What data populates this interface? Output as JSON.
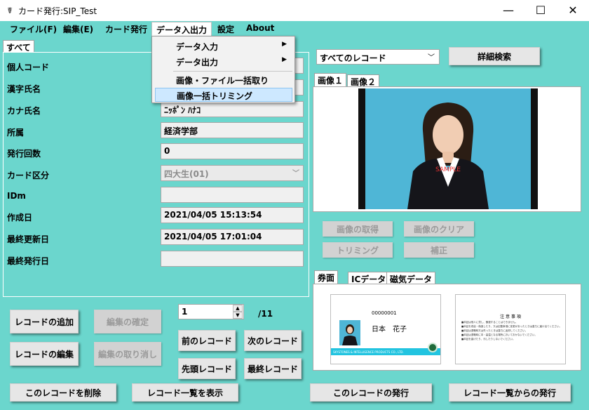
{
  "window": {
    "title": "カード発行:SIP_Test",
    "icon": "card-app-icon",
    "minimize": "—",
    "maximize": "☐",
    "close": "✕"
  },
  "menu": [
    "ファイル(F)",
    "編集(E)",
    "カード発行",
    "データ入出力",
    "設定",
    "About"
  ],
  "dropdown": {
    "items": [
      {
        "label": "データ入力",
        "submenu": true
      },
      {
        "label": "データ出力",
        "submenu": true
      },
      {
        "label": "画像・ファイル一括取り込み",
        "submenu": false
      },
      {
        "label": "画像一括トリミング",
        "submenu": false,
        "selected": true
      }
    ],
    "arrow": "▶"
  },
  "left_tab": "すべて",
  "fields": [
    {
      "label": "個人コード",
      "value": ""
    },
    {
      "label": "漢字氏名",
      "value": ""
    },
    {
      "label": "カナ氏名",
      "value": "ﾆｯﾎﾟﾝ ﾊﾅｺ"
    },
    {
      "label": "所属",
      "value": "経済学部"
    },
    {
      "label": "発行回数",
      "value": "0"
    },
    {
      "label": "カード区分",
      "value": "四大生(01)",
      "dropdown": true,
      "disabled": true
    },
    {
      "label": "IDm",
      "value": ""
    },
    {
      "label": "作成日",
      "value": "2021/04/05 15:13:54"
    },
    {
      "label": "最終更新日",
      "value": "2021/04/05 17:01:04"
    },
    {
      "label": "最終発行日",
      "value": ""
    }
  ],
  "dropdown_arrow": "﹀",
  "record_select": {
    "value": "すべてのレコード",
    "arrow": "﹀"
  },
  "buttons": {
    "detail_search": "詳細検索",
    "add_record": "レコードの追加",
    "confirm_edit": "編集の確定",
    "edit_record": "レコードの編集",
    "cancel_edit": "編集の取り消し",
    "prev_record": "前のレコード",
    "next_record": "次のレコード",
    "first_record": "先頭レコード",
    "last_record": "最終レコード",
    "delete_record": "このレコードを削除",
    "show_list": "レコード一覧を表示",
    "issue_record": "このレコードの発行",
    "issue_from_list": "レコード一覧からの発行",
    "get_image": "画像の取得",
    "clear_image": "画像のクリア",
    "trimming": "トリミング",
    "correction": "補正"
  },
  "record_nav": {
    "current": "1",
    "total": "/11",
    "up": "▲",
    "down": "▼"
  },
  "image_tabs": [
    "画像１",
    "画像２"
  ],
  "photo_watermark": "SAMPLE",
  "card_tabs": [
    "券面",
    "ICデータ",
    "磁気データ"
  ],
  "card_front": {
    "number": "00000001",
    "name": "日本　花子",
    "company": "SKYSTONES & INTELLIGENCE PRODUCTS CO., LTD."
  },
  "card_back": {
    "title": "注 意 事 項",
    "lines": [
      "■本証は他人に貸し、譲渡することはできません。",
      "■本証を改竄・偽造したり、又は記載事項に変更があったときは直ちに届け出てください。",
      "■本証は退職時又は失ったときは直ちに返却してください。",
      "■本証は退職時に本・高温となる場所においておかないでください。",
      "■本証を曲げたり、汚したりしないでください。"
    ]
  },
  "colors": {
    "background": "#6bd6cd",
    "selected_menu": "#cde8ff",
    "card_stripe": "#22c4e0"
  }
}
